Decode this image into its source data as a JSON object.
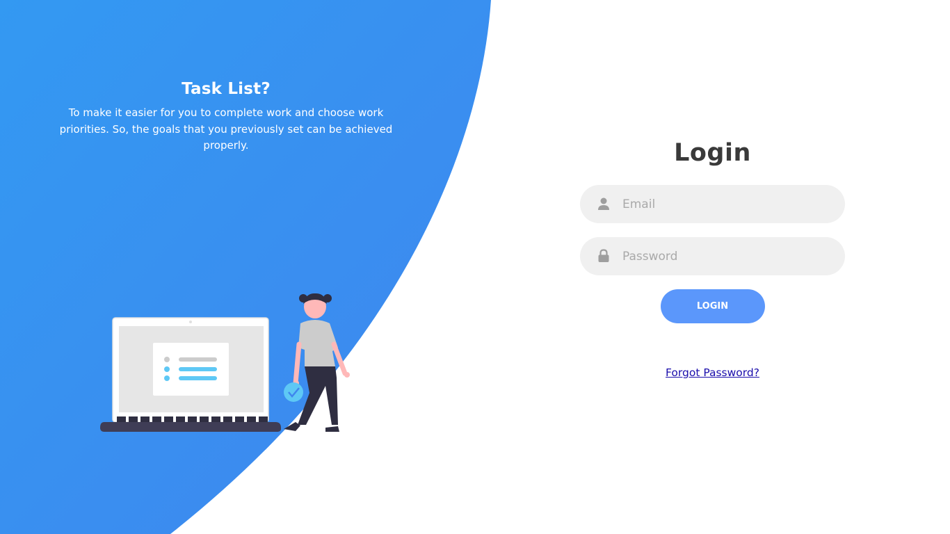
{
  "intro": {
    "title": "Task List?",
    "text": "To make it easier for you to complete work and choose work priorities. So, the goals that you previously set can be achieved properly."
  },
  "login": {
    "title": "Login",
    "email_placeholder": "Email",
    "password_placeholder": "Password",
    "button_label": "LOGIN",
    "forgot_label": "Forgot Password?"
  },
  "icons": {
    "email": "user-icon",
    "password": "lock-icon"
  },
  "colors": {
    "panel_gradient_start": "#3399f2",
    "panel_gradient_end": "#3f86ee",
    "button": "#5b97fb",
    "input_bg": "#f0f0f0",
    "title": "#3a3a3a",
    "link": "#1a0dab"
  }
}
